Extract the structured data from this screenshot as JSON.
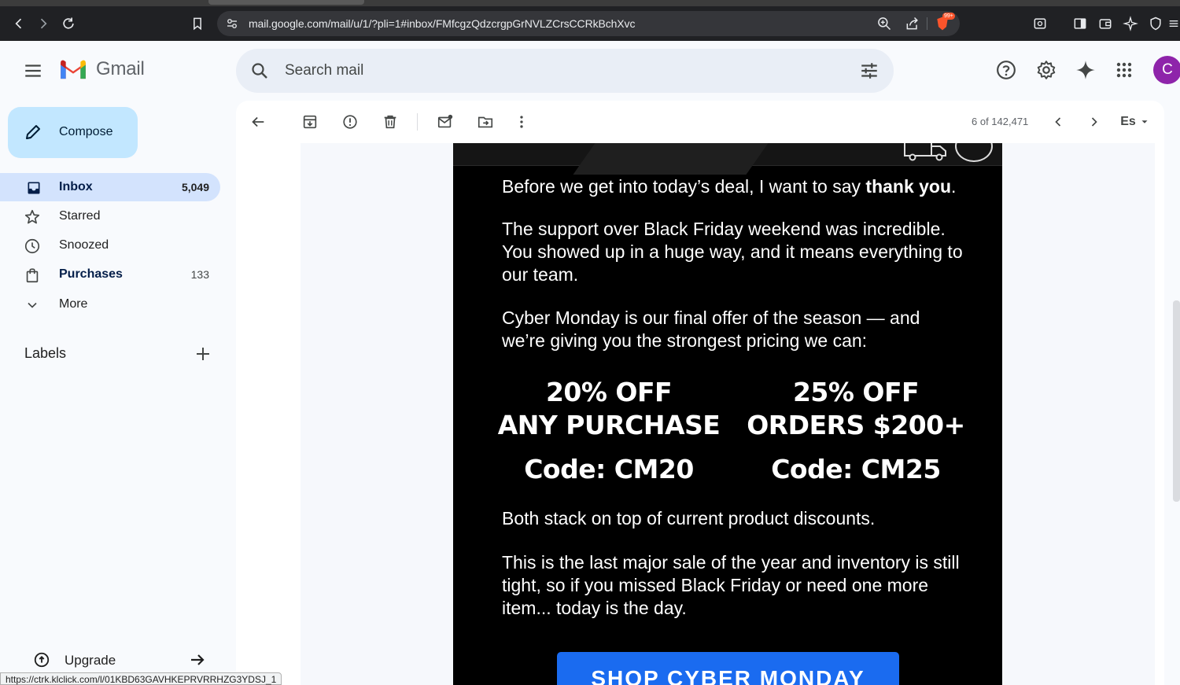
{
  "browser": {
    "url": "mail.google.com/mail/u/1/?pli=1#inbox/FMfcgzQdzcrgpGrNVLZCrsCCRkBchXvc",
    "brave_badge": "99+",
    "status_url": "https://ctrk.klclick.com/l/01KBD63GAVHKEPRVRRHZG3YDSJ_1"
  },
  "header": {
    "app_name": "Gmail",
    "search_placeholder": "Search mail",
    "avatar_initial": "C"
  },
  "sidebar": {
    "compose_label": "Compose",
    "items": [
      {
        "label": "Inbox",
        "count": "5,049",
        "icon": "inbox-icon",
        "active": true
      },
      {
        "label": "Starred",
        "count": "",
        "icon": "star-icon"
      },
      {
        "label": "Snoozed",
        "count": "",
        "icon": "clock-icon"
      },
      {
        "label": "Purchases",
        "count": "133",
        "icon": "shopping-bag-icon"
      },
      {
        "label": "More",
        "count": "",
        "icon": "chevron-down-icon"
      }
    ],
    "labels_heading": "Labels",
    "upgrade_label": "Upgrade"
  },
  "message_toolbar": {
    "pager": "6 of 142,471",
    "input_tools_label": "Es"
  },
  "email": {
    "p1_normal": "Before we get into today’s deal, I want to say ",
    "p1_bold": "thank you",
    "p1_end": ".",
    "p2": "The support over Black Friday weekend was incredible. You showed up in a huge way, and it means everything to our team.",
    "p3": "Cyber Monday is our final offer of the season — and we’re giving you the strongest pricing we can:",
    "deal_left_line1": "20% OFF",
    "deal_left_line2": "ANY PURCHASE",
    "deal_left_code": "Code: CM20",
    "deal_right_line1": "25% OFF",
    "deal_right_line2": "ORDERS $200+",
    "deal_right_code": "Code: CM25",
    "p4": "Both stack on top of current product discounts.",
    "p5": "This is the last major sale of the year and inventory is still tight, so if you missed Black Friday or need one more item... today is the day.",
    "cta_label": "SHOP CYBER MONDAY"
  },
  "colors": {
    "compose_bg": "#c2e7ff",
    "active_nav_bg": "#d3e3fd",
    "search_bg": "#e9eef6",
    "avatar_bg": "#8e24aa",
    "cta_bg": "#1a6bf0",
    "email_bg": "#000000"
  }
}
